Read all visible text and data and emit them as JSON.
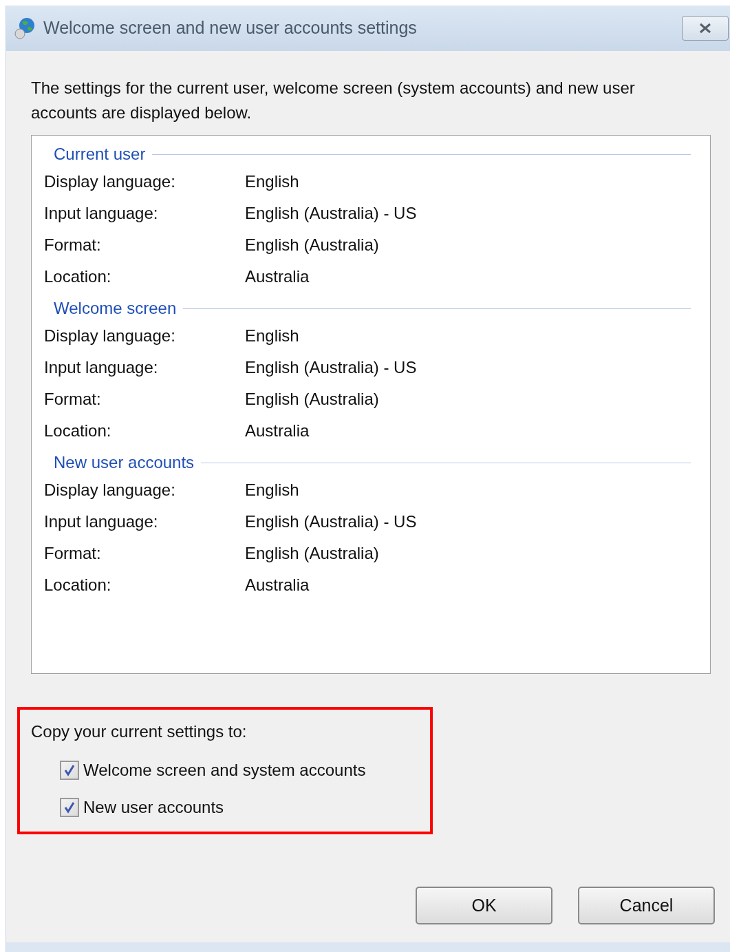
{
  "window": {
    "title": "Welcome screen and new user accounts settings"
  },
  "description": "The settings for the current user, welcome screen (system accounts) and new user accounts are displayed below.",
  "sections": [
    {
      "title": "Current user",
      "rows": [
        {
          "label": "Display language:",
          "value": "English"
        },
        {
          "label": "Input language:",
          "value": "English (Australia) - US"
        },
        {
          "label": "Format:",
          "value": "English (Australia)"
        },
        {
          "label": "Location:",
          "value": "Australia"
        }
      ]
    },
    {
      "title": "Welcome screen",
      "rows": [
        {
          "label": "Display language:",
          "value": "English"
        },
        {
          "label": "Input language:",
          "value": "English (Australia) - US"
        },
        {
          "label": "Format:",
          "value": "English (Australia)"
        },
        {
          "label": "Location:",
          "value": "Australia"
        }
      ]
    },
    {
      "title": "New user accounts",
      "rows": [
        {
          "label": "Display language:",
          "value": "English"
        },
        {
          "label": "Input language:",
          "value": "English (Australia) - US"
        },
        {
          "label": "Format:",
          "value": "English (Australia)"
        },
        {
          "label": "Location:",
          "value": "Australia"
        }
      ]
    }
  ],
  "copy": {
    "label": "Copy your current settings to:",
    "options": [
      {
        "label": "Welcome screen and system accounts",
        "checked": true
      },
      {
        "label": "New user accounts",
        "checked": true
      }
    ]
  },
  "buttons": [
    "OK",
    "Cancel"
  ]
}
